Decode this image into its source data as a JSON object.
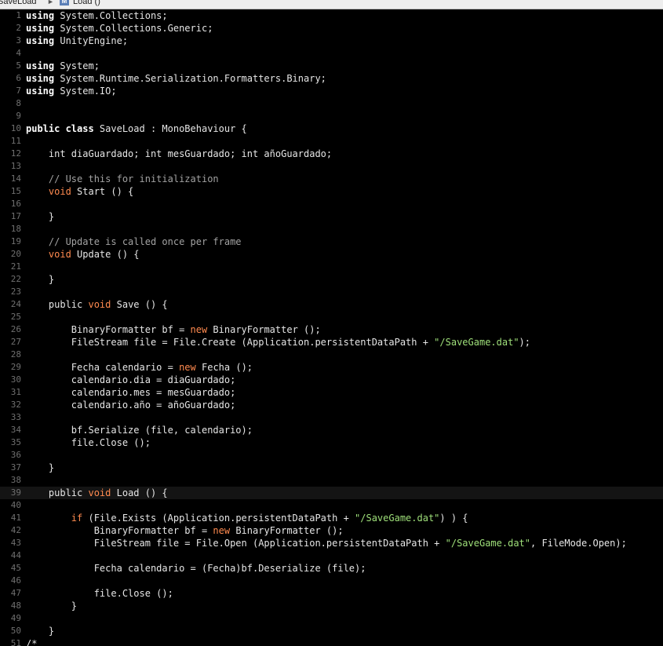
{
  "breadcrumb": {
    "file": "SaveLoad",
    "separator": "►",
    "method_icon": "M",
    "method": "Load ()"
  },
  "editor": {
    "current_line": 39,
    "colors": {
      "background": "#000000",
      "text": "#e6e6e6",
      "keyword": "#ffffff",
      "modifier": "#ff8a4f",
      "string": "#9fe07a",
      "comment": "#a2a2a2",
      "line_number": "#6f6f6f"
    },
    "lines": [
      {
        "n": "1",
        "t": [
          {
            "c": "kw",
            "s": "using"
          },
          {
            "s": " System.Collections;"
          }
        ]
      },
      {
        "n": "2",
        "t": [
          {
            "c": "kw",
            "s": "using"
          },
          {
            "s": " System.Collections.Generic;"
          }
        ]
      },
      {
        "n": "3",
        "t": [
          {
            "c": "kw",
            "s": "using"
          },
          {
            "s": " UnityEngine;"
          }
        ]
      },
      {
        "n": "4",
        "t": []
      },
      {
        "n": "5",
        "t": [
          {
            "c": "kw",
            "s": "using"
          },
          {
            "s": " System;"
          }
        ]
      },
      {
        "n": "6",
        "t": [
          {
            "c": "kw",
            "s": "using"
          },
          {
            "s": " System.Runtime.Serialization.Formatters.Binary;"
          }
        ]
      },
      {
        "n": "7",
        "t": [
          {
            "c": "kw",
            "s": "using"
          },
          {
            "s": " System.IO;"
          }
        ]
      },
      {
        "n": "8",
        "t": []
      },
      {
        "n": "9",
        "t": []
      },
      {
        "n": "10",
        "t": [
          {
            "c": "kw",
            "s": "public class"
          },
          {
            "s": " SaveLoad : MonoBehaviour {"
          }
        ]
      },
      {
        "n": "11",
        "t": []
      },
      {
        "n": "12",
        "t": [
          {
            "s": "    int diaGuardado; int mesGuardado; int añoGuardado;"
          }
        ]
      },
      {
        "n": "13",
        "t": []
      },
      {
        "n": "14",
        "t": [
          {
            "c": "cmt",
            "s": "    // Use this for initialization"
          }
        ]
      },
      {
        "n": "15",
        "t": [
          {
            "c": "kw2",
            "s": "    void"
          },
          {
            "s": " Start () {"
          }
        ]
      },
      {
        "n": "16",
        "t": []
      },
      {
        "n": "17",
        "t": [
          {
            "s": "    }"
          }
        ]
      },
      {
        "n": "18",
        "t": []
      },
      {
        "n": "19",
        "t": [
          {
            "c": "cmt",
            "s": "    // Update is called once per frame"
          }
        ]
      },
      {
        "n": "20",
        "t": [
          {
            "c": "kw2",
            "s": "    void"
          },
          {
            "s": " Update () {"
          }
        ]
      },
      {
        "n": "21",
        "t": []
      },
      {
        "n": "22",
        "t": [
          {
            "s": "    }"
          }
        ]
      },
      {
        "n": "23",
        "t": []
      },
      {
        "n": "24",
        "t": [
          {
            "s": "    public "
          },
          {
            "c": "kw2",
            "s": "void"
          },
          {
            "s": " Save () {"
          }
        ]
      },
      {
        "n": "25",
        "t": []
      },
      {
        "n": "26",
        "t": [
          {
            "s": "        BinaryFormatter bf = "
          },
          {
            "c": "kw2",
            "s": "new"
          },
          {
            "s": " BinaryFormatter ();"
          }
        ]
      },
      {
        "n": "27",
        "t": [
          {
            "s": "        FileStream file = File.Create (Application.persistentDataPath + "
          },
          {
            "c": "str",
            "s": "\"/SaveGame.dat\""
          },
          {
            "s": ");"
          }
        ]
      },
      {
        "n": "28",
        "t": []
      },
      {
        "n": "29",
        "t": [
          {
            "s": "        Fecha calendario = "
          },
          {
            "c": "kw2",
            "s": "new"
          },
          {
            "s": " Fecha ();"
          }
        ]
      },
      {
        "n": "30",
        "t": [
          {
            "s": "        calendario.dia = diaGuardado;"
          }
        ]
      },
      {
        "n": "31",
        "t": [
          {
            "s": "        calendario.mes = mesGuardado;"
          }
        ]
      },
      {
        "n": "32",
        "t": [
          {
            "s": "        calendario.año = añoGuardado;"
          }
        ]
      },
      {
        "n": "33",
        "t": []
      },
      {
        "n": "34",
        "t": [
          {
            "s": "        bf.Serialize (file, calendario);"
          }
        ]
      },
      {
        "n": "35",
        "t": [
          {
            "s": "        file.Close ();"
          }
        ]
      },
      {
        "n": "36",
        "t": []
      },
      {
        "n": "37",
        "t": [
          {
            "s": "    }"
          }
        ]
      },
      {
        "n": "38",
        "t": []
      },
      {
        "n": "39",
        "t": [
          {
            "s": "    public "
          },
          {
            "c": "kw2",
            "s": "void"
          },
          {
            "s": " Load () {"
          }
        ]
      },
      {
        "n": "40",
        "t": []
      },
      {
        "n": "41",
        "t": [
          {
            "c": "kw2",
            "s": "        if"
          },
          {
            "s": " (File.Exists (Application.persistentDataPath + "
          },
          {
            "c": "str",
            "s": "\"/SaveGame.dat\""
          },
          {
            "s": ") ) {"
          }
        ]
      },
      {
        "n": "42",
        "t": [
          {
            "s": "            BinaryFormatter bf = "
          },
          {
            "c": "kw2",
            "s": "new"
          },
          {
            "s": " BinaryFormatter ();"
          }
        ]
      },
      {
        "n": "43",
        "t": [
          {
            "s": "            FileStream file = File.Open (Application.persistentDataPath + "
          },
          {
            "c": "str",
            "s": "\"/SaveGame.dat\""
          },
          {
            "s": ", FileMode.Open);"
          }
        ]
      },
      {
        "n": "44",
        "t": []
      },
      {
        "n": "45",
        "t": [
          {
            "s": "            Fecha calendario = (Fecha)bf.Deserialize (file);"
          }
        ]
      },
      {
        "n": "46",
        "t": []
      },
      {
        "n": "47",
        "t": [
          {
            "s": "            file.Close ();"
          }
        ]
      },
      {
        "n": "48",
        "t": [
          {
            "s": "        }"
          }
        ]
      },
      {
        "n": "49",
        "t": []
      },
      {
        "n": "50",
        "t": [
          {
            "s": "    }"
          }
        ]
      },
      {
        "n": "51",
        "t": [
          {
            "s": "/*"
          }
        ]
      }
    ]
  }
}
